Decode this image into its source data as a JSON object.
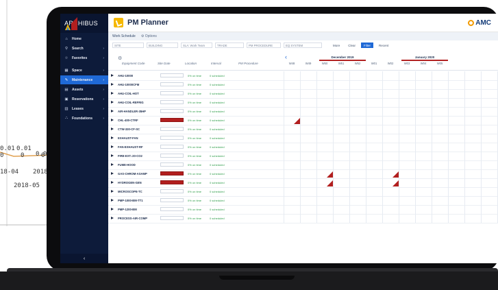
{
  "bg_chart": {
    "labels": [
      {
        "name": "bg-chart-value-1",
        "text": "0.01"
      },
      {
        "name": "bg-chart-value-2",
        "text": "0.01"
      },
      {
        "name": "bg-chart-value-3",
        "text": "0.0"
      },
      {
        "name": "bg-chart-zero-1",
        "text": "0"
      },
      {
        "name": "bg-chart-zero-2",
        "text": "0"
      },
      {
        "name": "bg-chart-zero-3",
        "text": "0"
      },
      {
        "name": "bg-chart-date-1",
        "text": "18-04"
      },
      {
        "name": "bg-chart-date-2",
        "text": "2018-0"
      },
      {
        "name": "bg-chart-date-3",
        "text": "2018-05"
      },
      {
        "name": "bg-chart-date-4",
        "text": "2"
      }
    ]
  },
  "sidebar": {
    "logo_text": "ARCHIBUS",
    "items": [
      {
        "label": "Home",
        "icon": "home-icon",
        "glyph": "⌂",
        "arrow": ""
      },
      {
        "label": "Search",
        "icon": "search-icon",
        "glyph": "⚲",
        "arrow": "›"
      },
      {
        "label": "Favorites",
        "icon": "star-icon",
        "glyph": "☆",
        "arrow": "›"
      },
      {
        "label": "Space",
        "icon": "space-icon",
        "glyph": "▦",
        "arrow": "›"
      },
      {
        "label": "Maintenance",
        "icon": "wrench-icon",
        "glyph": "✎",
        "arrow": "›",
        "active": true
      },
      {
        "label": "Assets",
        "icon": "assets-icon",
        "glyph": "▤",
        "arrow": "›"
      },
      {
        "label": "Reservations",
        "icon": "calendar-icon",
        "glyph": "▣",
        "arrow": "›"
      },
      {
        "label": "Leases",
        "icon": "leases-icon",
        "glyph": "▥",
        "arrow": "›"
      },
      {
        "label": "Foundations",
        "icon": "foundations-icon",
        "glyph": "⛬",
        "arrow": "›"
      }
    ],
    "collapse_glyph": "‹"
  },
  "header": {
    "title": "PM Planner",
    "brand": "AMC"
  },
  "tabs": {
    "active": "Work Schedule",
    "options": "Options",
    "options_glyph": "⚙"
  },
  "filters": {
    "fields": [
      "SITE",
      "BUILDING",
      "SLA: Work Team",
      "TRADE",
      "PM PROCEDURE",
      "EQ SYSTEM"
    ],
    "more": "More",
    "clear": "Clear",
    "filter": "Filter",
    "recent": "Recent"
  },
  "grid": {
    "columns": [
      "Equipment Code",
      "Site Date",
      "Location",
      "Interval",
      "PM Procedure"
    ],
    "months": [
      "December 2019",
      "January 2020"
    ],
    "weeks": [
      "W48",
      "W49",
      "W50",
      "W51",
      "W52",
      "W01",
      "W02",
      "W03",
      "W04",
      "W05"
    ],
    "rows": [
      {
        "code": "AHU-10000",
        "status": "0% on time",
        "sched": "0 scheduled",
        "red": false
      },
      {
        "code": "AHU-10000CFM",
        "status": "0% on time",
        "sched": "0 scheduled",
        "red": false
      },
      {
        "code": "AHU-COIL-HOT",
        "status": "0% on time",
        "sched": "0 scheduled",
        "red": false
      },
      {
        "code": "AHU-COIL-REFRIG",
        "status": "0% on time",
        "sched": "0 scheduled",
        "red": false
      },
      {
        "code": "AIR-HANDLER-35HP",
        "status": "0% on time",
        "sched": "0 scheduled",
        "red": false
      },
      {
        "code": "CHL-400-CTRF",
        "status": "0% on time",
        "sched": "0 scheduled",
        "red": true
      },
      {
        "code": "CTW-330-CF-SC",
        "status": "0% on time",
        "sched": "0 scheduled",
        "red": false
      },
      {
        "code": "EXHAUST-FAN",
        "status": "0% on time",
        "sched": "0 scheduled",
        "red": false
      },
      {
        "code": "FAN-EXHAUST-RF",
        "status": "0% on time",
        "sched": "0 scheduled",
        "red": false
      },
      {
        "code": "FIRE-EXT.-20-CO2",
        "status": "0% on time",
        "sched": "0 scheduled",
        "red": false
      },
      {
        "code": "FUME-HOOD",
        "status": "0% on time",
        "sched": "0 scheduled",
        "red": false
      },
      {
        "code": "GAS-CHROM-ASAMP",
        "status": "0% on time",
        "sched": "0 scheduled",
        "red": true
      },
      {
        "code": "HYDROGEN-GEN",
        "status": "0% on time",
        "sched": "0 scheduled",
        "red": true
      },
      {
        "code": "MICROSCOPE-TC",
        "status": "0% on time",
        "sched": "0 scheduled",
        "red": false
      },
      {
        "code": "PMP-1000-BM-TT1",
        "status": "0% on time",
        "sched": "0 scheduled",
        "red": false
      },
      {
        "code": "PMP-1200-BM",
        "status": "0% on time",
        "sched": "0 scheduled",
        "red": false
      },
      {
        "code": "PROCESS-AIR-COMP",
        "status": "0% on time",
        "sched": "0 scheduled",
        "red": false
      }
    ],
    "markers": [
      {
        "row": 5,
        "week": "W48",
        "label": "3"
      },
      {
        "row": 11,
        "week": "W50",
        "label": "2"
      },
      {
        "row": 11,
        "week": "W02",
        "label": "1"
      },
      {
        "row": 12,
        "week": "W50",
        "label": "3"
      },
      {
        "row": 12,
        "week": "W02",
        "label": "4"
      }
    ]
  }
}
